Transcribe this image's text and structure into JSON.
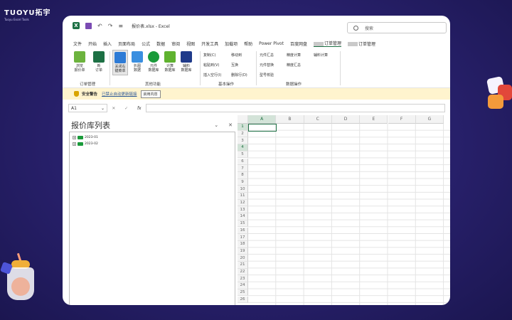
{
  "brand": {
    "name": "TUOYU拓宇",
    "tagline": "Tuoyu Excel Tools"
  },
  "titlebar": {
    "doc_title": "报价表.xlsx - Excel",
    "search_placeholder": "搜索"
  },
  "tabs": [
    "文件",
    "开始",
    "插入",
    "页面布局",
    "公式",
    "数据",
    "审阅",
    "视图",
    "开发工具",
    "加载项",
    "帮助",
    "Power Pivot",
    "百度网盘"
  ],
  "custom_tabs": [
    {
      "label": "订单管理",
      "active": true
    },
    {
      "label": "订单管理",
      "active": false
    }
  ],
  "ribbon": {
    "order_group": {
      "label": "订单管理",
      "buttons": [
        {
          "label": "浏览\n报价单",
          "icon": "folder-open-icon",
          "color": "#6cb33e"
        },
        {
          "label": "新\n订单",
          "icon": "new-order-icon",
          "color": "#1d7044"
        }
      ]
    },
    "other_group": {
      "label": "其他功能",
      "buttons": [
        {
          "label": "关闭右\n键菜单",
          "icon": "grid-menu-icon",
          "color": "#2d7bd6"
        },
        {
          "label": "扒图\n数据",
          "icon": "image-data-icon",
          "color": "#3a8fe0"
        },
        {
          "label": "元件\n数据库",
          "icon": "component-db-icon",
          "color": "#1a9a3a"
        },
        {
          "label": "计算\n数据库",
          "icon": "calc-db-icon",
          "color": "#5fb22f"
        },
        {
          "label": "辅料\n数据库",
          "icon": "material-db-icon",
          "color": "#1f3a8a"
        }
      ]
    },
    "basic_group": {
      "label": "基本操作",
      "items": [
        "复制(C)",
        "移动到",
        "粘贴到(V)",
        "互换",
        "插入空行(I)",
        "删除行(D)"
      ]
    },
    "data_group": {
      "label": "数据操作",
      "items": [
        "元件汇总",
        "精度计算",
        "辅料计算",
        "元件替换",
        "精度汇总",
        "型号校验"
      ]
    }
  },
  "security_bar": {
    "title": "安全警告",
    "message": "已禁止自动更新链接",
    "button": "启用内容"
  },
  "formula_bar": {
    "name_box": "A1",
    "value": ""
  },
  "pane": {
    "title": "报价库列表",
    "tree": [
      "2023-01",
      "2023-02"
    ]
  },
  "grid": {
    "columns": [
      "A",
      "B",
      "C",
      "D",
      "E",
      "F",
      "G"
    ],
    "rows": [
      "1",
      "2",
      "3",
      "4",
      "5",
      "6",
      "7",
      "8",
      "9",
      "10",
      "11",
      "12",
      "13",
      "14",
      "15",
      "16",
      "17",
      "18",
      "19",
      "20",
      "21",
      "22",
      "23",
      "24",
      "25",
      "26"
    ],
    "active_cell": "A1"
  },
  "colors": {
    "accent": "#1d7044",
    "background": "#2a2270",
    "security_bg": "#fff4ce"
  }
}
